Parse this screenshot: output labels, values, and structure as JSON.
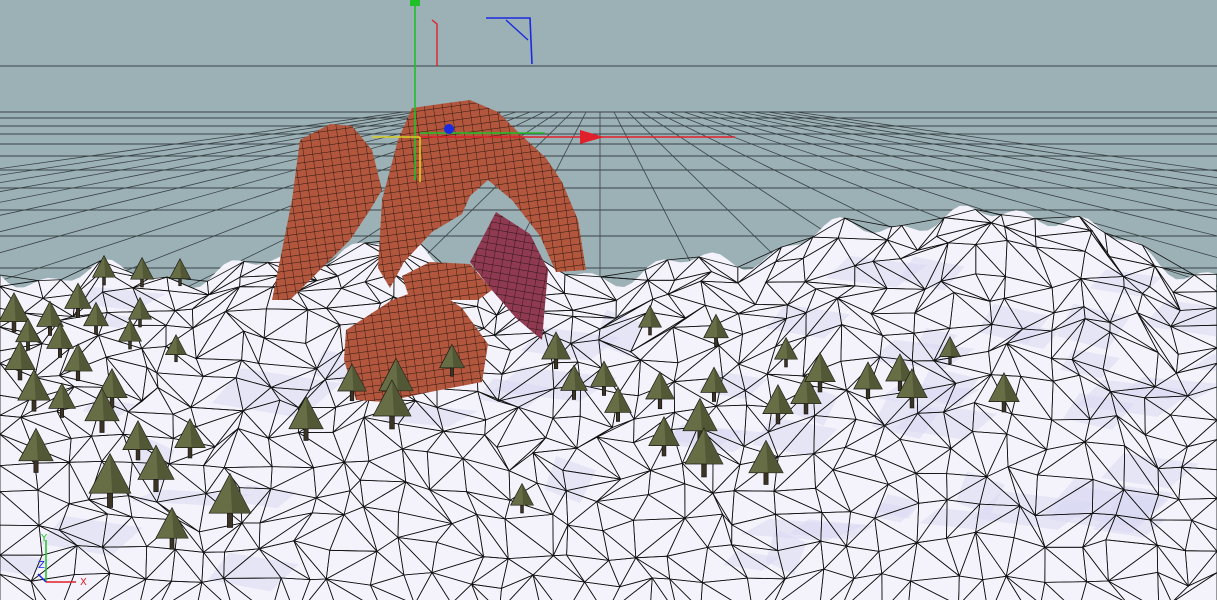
{
  "viewport": {
    "sky_color": "#9cb1b6",
    "snow_color": "#f4f3fb",
    "snow_shadow_color": "#d8d8f2",
    "wireframe_color": "#111111",
    "selected_mesh_color": "#b2573d",
    "selected_mesh_shadow_color": "#8f3a52",
    "tree_color": "#676d45",
    "trunk_color": "#3b3324"
  },
  "gizmo": {
    "x_axis_color": "#e0202a",
    "y_axis_color": "#20c028",
    "z_axis_color": "#1a2ae0",
    "corner_axes": {
      "y_label": "Y",
      "z_label": "Z",
      "x_label": "X"
    }
  }
}
